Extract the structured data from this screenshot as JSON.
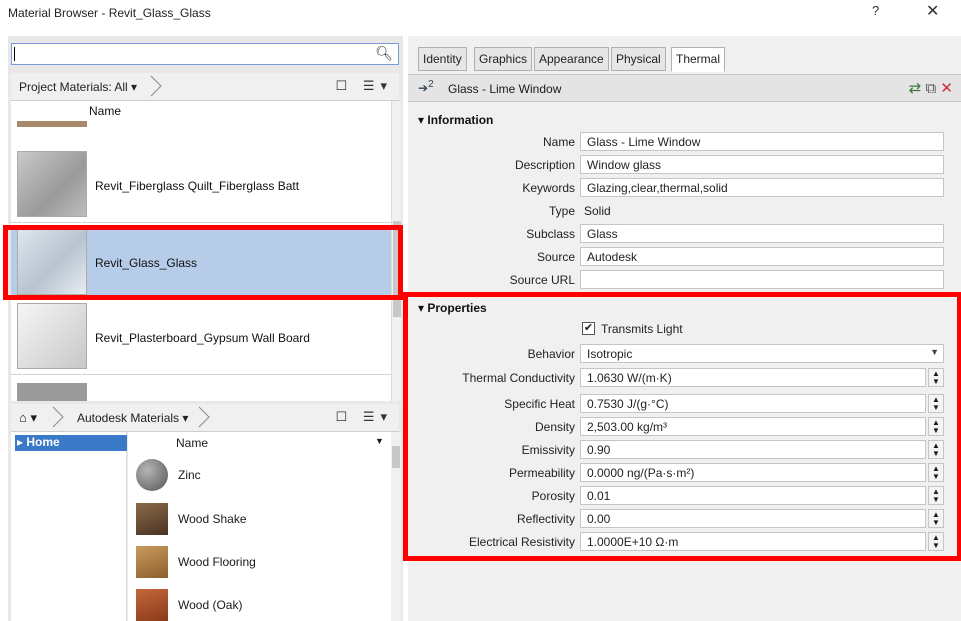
{
  "window": {
    "title": "Material Browser - Revit_Glass_Glass",
    "help": "?",
    "close": "✕"
  },
  "search": {
    "value": "",
    "placeholder": ""
  },
  "project": {
    "header": "Project Materials: All",
    "name_col": "Name",
    "items": [
      {
        "label": ""
      },
      {
        "label": "Revit_Fiberglass Quilt_Fiberglass Batt"
      },
      {
        "label": "Revit_Glass_Glass"
      },
      {
        "label": "Revit_Plasterboard_Gypsum Wall Board"
      }
    ]
  },
  "library": {
    "header": "Autodesk Materials",
    "home": "Home",
    "name_col": "Name",
    "items": [
      {
        "label": "Zinc",
        "color": "#6d6d6d"
      },
      {
        "label": "Wood Shake",
        "color": "#6b4a2f"
      },
      {
        "label": "Wood Flooring",
        "color": "#a6753f"
      },
      {
        "label": "Wood (Oak)",
        "color": "#a5522a"
      }
    ]
  },
  "tabs": [
    "Identity",
    "Graphics",
    "Appearance",
    "Physical",
    "Thermal"
  ],
  "active_tab": "Thermal",
  "material": {
    "name": "Glass - Lime Window",
    "badge": "2"
  },
  "information": {
    "title": "Information",
    "labels": {
      "name": "Name",
      "description": "Description",
      "keywords": "Keywords",
      "type": "Type",
      "subclass": "Subclass",
      "source": "Source",
      "source_url": "Source URL"
    },
    "values": {
      "name": "Glass - Lime Window",
      "description": "Window glass",
      "keywords": "Glazing,clear,thermal,solid",
      "type": "Solid",
      "subclass": "Glass",
      "source": "Autodesk",
      "source_url": ""
    }
  },
  "properties": {
    "title": "Properties",
    "transmits_light": "Transmits Light",
    "rows": [
      {
        "label": "Behavior",
        "value": "Isotropic"
      },
      {
        "label": "Thermal Conductivity",
        "value": "1.0630 W/(m·K)"
      },
      {
        "label": "Specific Heat",
        "value": "0.7530 J/(g·°C)"
      },
      {
        "label": "Density",
        "value": "2,503.00 kg/m³"
      },
      {
        "label": "Emissivity",
        "value": "0.90"
      },
      {
        "label": "Permeability",
        "value": "0.0000 ng/(Pa·s·m²)"
      },
      {
        "label": "Porosity",
        "value": "0.01"
      },
      {
        "label": "Reflectivity",
        "value": "0.00"
      },
      {
        "label": "Electrical Resistivity",
        "value": "1.0000E+10 Ω·m"
      }
    ]
  },
  "colors": {
    "highlight": "#ff0000",
    "selection": "#b7cce8"
  }
}
